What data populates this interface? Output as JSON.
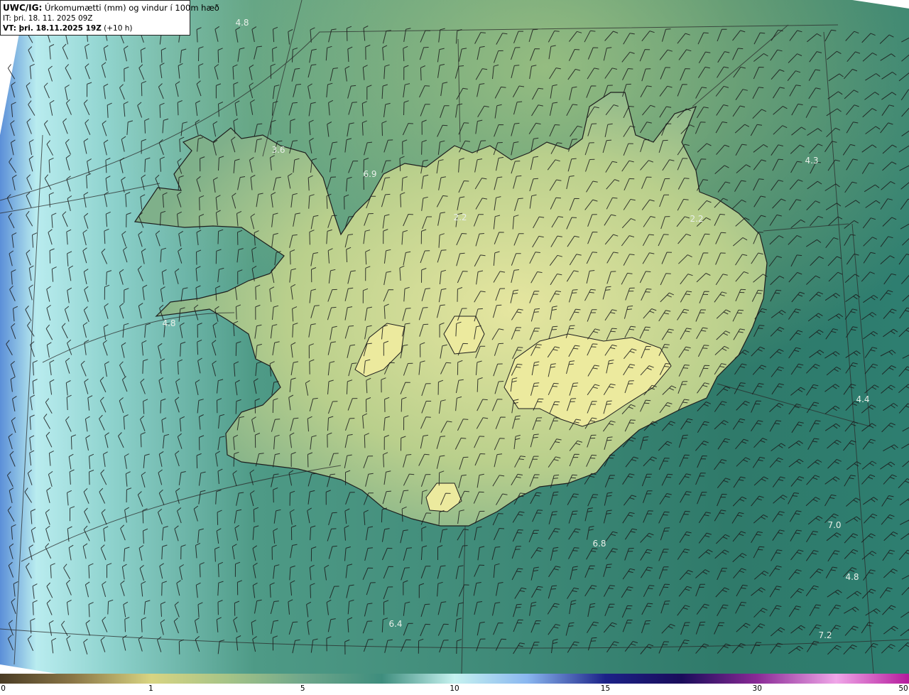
{
  "title": {
    "code": "UWC/IG:",
    "description": "Úrkomumætti (mm) og vindur í 100m hæð",
    "issue_time": "IT: þri. 18. 11. 2025 09Z",
    "valid_label": "VT: þri. 18.11.2025 19Z",
    "valid_offset": "(+10 h)"
  },
  "map_labels": [
    {
      "text": "4.8",
      "id": "northwest"
    },
    {
      "text": "3.6",
      "id": "westfjords"
    },
    {
      "text": "6.9",
      "id": "north-central"
    },
    {
      "text": "4.3",
      "id": "northeast-sea"
    },
    {
      "text": "2.2",
      "id": "northeast"
    },
    {
      "text": "2.2",
      "id": "north"
    },
    {
      "text": "4.8",
      "id": "west"
    },
    {
      "text": "4.4",
      "id": "east-sea"
    },
    {
      "text": "7.0",
      "id": "southeast-sea"
    },
    {
      "text": "6.8",
      "id": "south-sea"
    },
    {
      "text": "4.8",
      "id": "far-southeast-sea"
    },
    {
      "text": "6.4",
      "id": "south"
    },
    {
      "text": "7.2",
      "id": "far-south-east"
    }
  ],
  "colorbar": {
    "ticks": [
      "0",
      "1",
      "5",
      "10",
      "15",
      "30",
      "50"
    ],
    "colors": [
      "#4a3c24",
      "#8a7646",
      "#d8d482",
      "#6fa78b",
      "#3e8d7d",
      "#c6f2f0",
      "#8ab7f0",
      "#1c2288",
      "#1a0c5a",
      "#8a2a96",
      "#f0a6e8",
      "#b41a9c"
    ]
  },
  "colors": {
    "land_high": "#e3e39c",
    "land_low": "#7fb08a",
    "sea": "#3d8a78",
    "sea_west": "#a8e2e4",
    "coast": "#1e1e1e",
    "grid": "#2a2a2a",
    "label": "#e8efe8"
  }
}
